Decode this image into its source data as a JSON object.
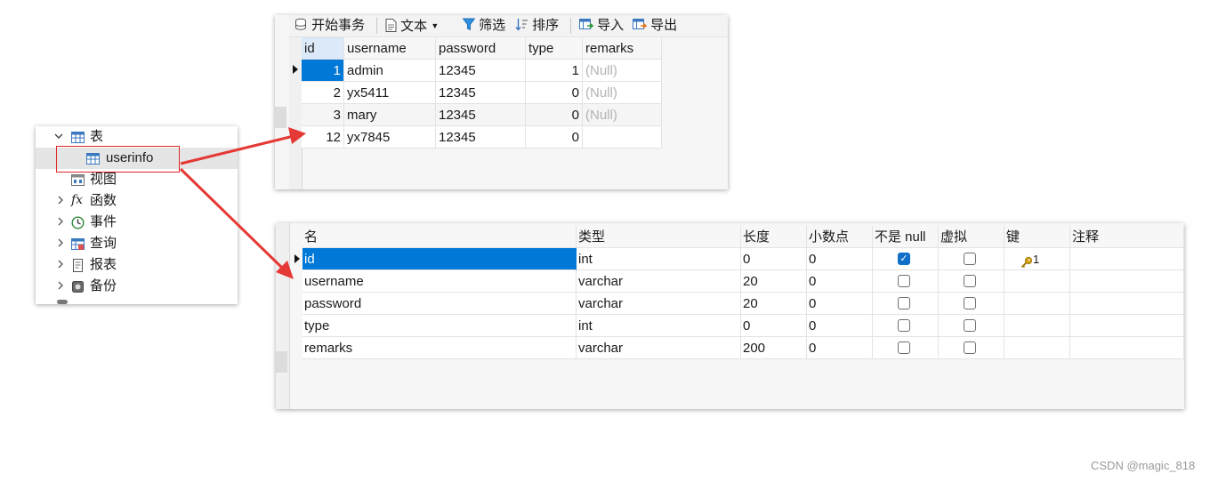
{
  "tree": {
    "items": [
      {
        "label": "表",
        "icon": "table-icon",
        "expander": "expanded"
      },
      {
        "label": "userinfo",
        "icon": "table-icon",
        "expander": "none",
        "selected": true
      },
      {
        "label": "视图",
        "icon": "view-icon",
        "expander": "none"
      },
      {
        "label": "函数",
        "icon": "function-icon",
        "icon_glyph": "fx",
        "expander": "collapsed"
      },
      {
        "label": "事件",
        "icon": "event-clock-icon",
        "expander": "collapsed"
      },
      {
        "label": "查询",
        "icon": "query-icon",
        "expander": "collapsed"
      },
      {
        "label": "报表",
        "icon": "report-icon",
        "expander": "collapsed"
      },
      {
        "label": "备份",
        "icon": "backup-icon",
        "expander": "collapsed"
      }
    ]
  },
  "data_grid": {
    "toolbar": {
      "begin_transaction": "开始事务",
      "text": "文本",
      "filter": "筛选",
      "sort": "排序",
      "import": "导入",
      "export": "导出"
    },
    "columns": [
      "id",
      "username",
      "password",
      "type",
      "remarks"
    ],
    "rows": [
      {
        "id": "1",
        "username": "admin",
        "password": "12345",
        "type": "1",
        "remarks": "(Null)"
      },
      {
        "id": "2",
        "username": "yx5411",
        "password": "12345",
        "type": "0",
        "remarks": "(Null)"
      },
      {
        "id": "3",
        "username": "mary",
        "password": "12345",
        "type": "0",
        "remarks": "(Null)"
      },
      {
        "id": "12",
        "username": "yx7845",
        "password": "12345",
        "type": "0",
        "remarks": ""
      }
    ]
  },
  "structure": {
    "columns": [
      "名",
      "类型",
      "长度",
      "小数点",
      "不是 null",
      "虚拟",
      "键",
      "注释"
    ],
    "fields": [
      {
        "name": "id",
        "type": "int",
        "length": "0",
        "decimals": "0",
        "not_null": true,
        "virtual": false,
        "key": "1"
      },
      {
        "name": "username",
        "type": "varchar",
        "length": "20",
        "decimals": "0",
        "not_null": false,
        "virtual": false,
        "key": ""
      },
      {
        "name": "password",
        "type": "varchar",
        "length": "20",
        "decimals": "0",
        "not_null": false,
        "virtual": false,
        "key": ""
      },
      {
        "name": "type",
        "type": "int",
        "length": "0",
        "decimals": "0",
        "not_null": false,
        "virtual": false,
        "key": ""
      },
      {
        "name": "remarks",
        "type": "varchar",
        "length": "200",
        "decimals": "0",
        "not_null": false,
        "virtual": false,
        "key": ""
      }
    ]
  },
  "colors": {
    "annotation_red": "#e53935",
    "selection_blue": "#0078d7",
    "null_gray": "#b3b3b3",
    "key_gold": "#d4a017"
  },
  "watermark": "CSDN @magic_818"
}
